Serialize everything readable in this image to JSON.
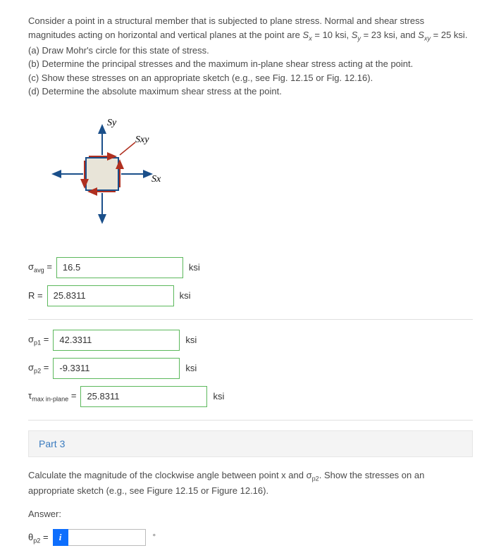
{
  "problem": {
    "intro": "Consider a point in a structural member that is subjected to plane stress. Normal and shear stress magnitudes acting on horizontal and vertical planes at the point are ",
    "sx_label": "S",
    "sx_sub": "x",
    "sx_val": " = 10 ksi, ",
    "sy_label": "S",
    "sy_sub": "y",
    "sy_val": " = 23 ksi, and ",
    "sxy_label": "S",
    "sxy_sub": "xy",
    "sxy_val": " = 25 ksi.",
    "a": "(a) Draw Mohr's circle for this state of stress.",
    "b": "(b) Determine the principal stresses and the maximum in-plane shear stress acting at the point.",
    "c": "(c) Show these stresses on an appropriate sketch (e.g., see Fig. 12.15 or Fig. 12.16).",
    "d": "(d) Determine the absolute maximum shear stress at the point."
  },
  "diagram": {
    "sy": "Sy",
    "sx": "Sx",
    "sxy": "Sxy"
  },
  "answers": {
    "sigma_avg_label": "σ",
    "avg_sub": "avg",
    "eq": " = ",
    "sigma_avg_val": "16.5",
    "r_label": "R = ",
    "r_val": "25.8311",
    "sp1_label": "σ",
    "p1_sub": "p1",
    "sp1_val": "42.3311",
    "sp2_label": "σ",
    "p2_sub": "p2",
    "sp2_val": "-9.3311",
    "tmax_label": "τ",
    "tmax_sub": "max in-plane",
    "tmax_val": "25.8311",
    "unit": "ksi"
  },
  "part3": {
    "title": "Part 3",
    "instruction": "Calculate the magnitude of the clockwise angle between point x and σ",
    "instruction_sub": "p2",
    "instruction_tail": ". Show the stresses on an appropriate sketch (e.g., see Figure 12.15 or Figure 12.16).",
    "answer_heading": "Answer:",
    "theta_label": "θ",
    "theta_sub": "p2",
    "theta_eq": " = ",
    "hint": "i",
    "theta_val": "",
    "degree": "°"
  }
}
